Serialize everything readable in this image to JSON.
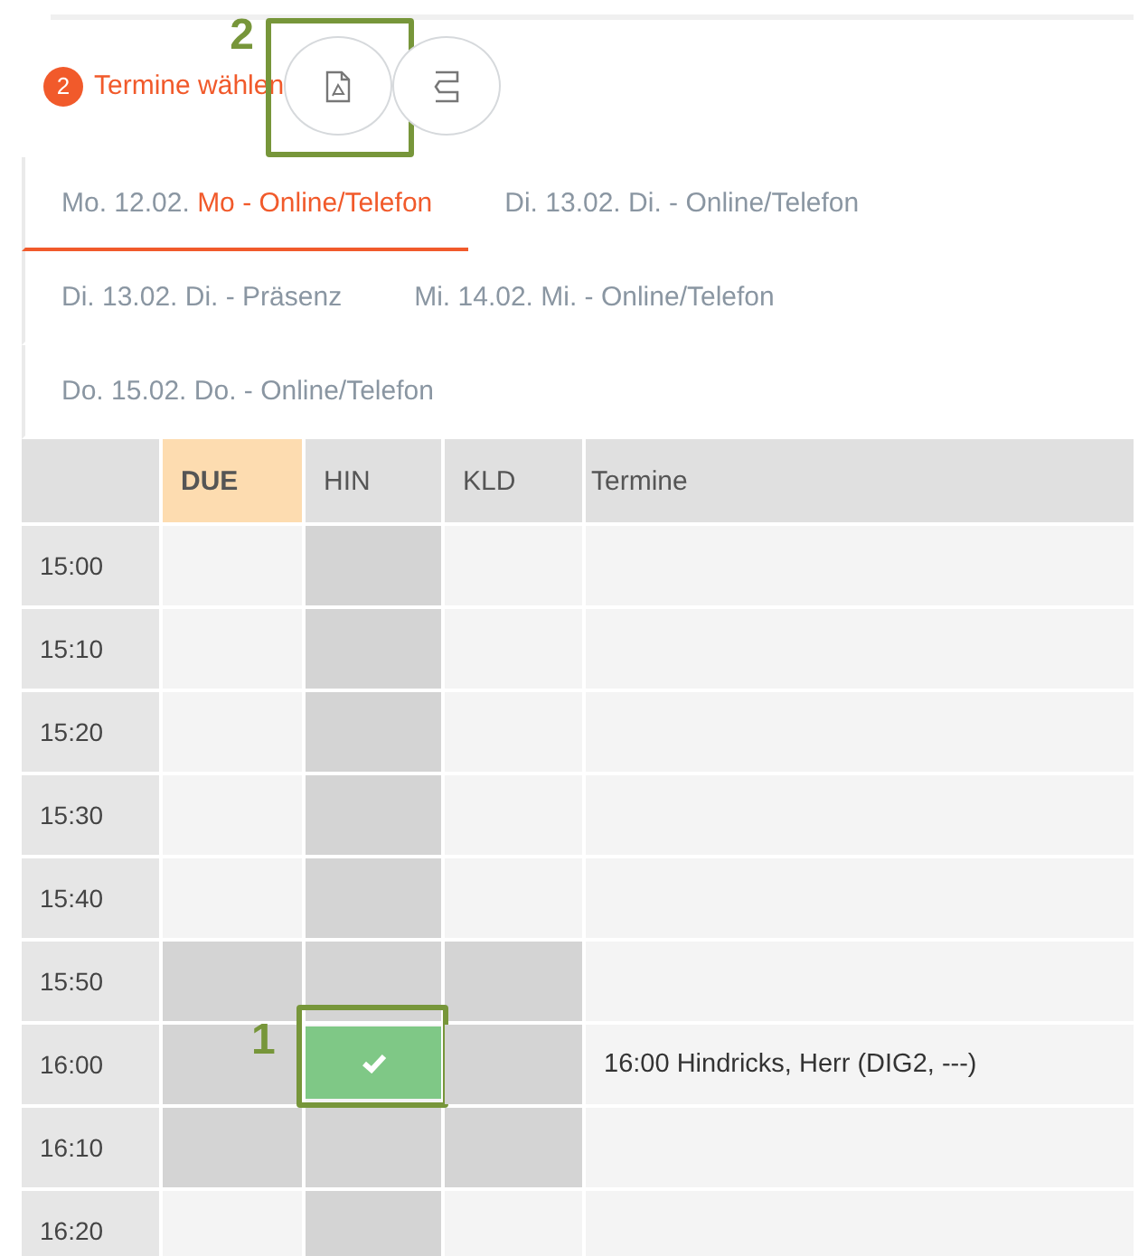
{
  "header": {
    "step": "2",
    "title": "Termine wählen",
    "buttons": [
      {
        "kind": "pdf",
        "callout": "2"
      },
      {
        "kind": "fold"
      }
    ]
  },
  "tabs": [
    {
      "date": "Mo. 12.02.",
      "label": "Mo - Online/Telefon",
      "selected": true
    },
    {
      "date": "Di. 13.02.",
      "label": "Di. - Online/Telefon",
      "selected": false
    },
    {
      "date": "Di. 13.02.",
      "label": "Di. - Präsenz",
      "selected": false
    },
    {
      "date": "Mi. 14.02.",
      "label": "Mi. - Online/Telefon",
      "selected": false
    },
    {
      "date": "Do. 15.02.",
      "label": "Do. - Online/Telefon",
      "selected": false
    }
  ],
  "table": {
    "columns": [
      {
        "label": "DUE",
        "selected": true
      },
      {
        "label": "HIN",
        "selected": false
      },
      {
        "label": "KLD",
        "selected": false
      }
    ],
    "entries_heading": "Termine",
    "rows": [
      {
        "time": "15:00",
        "slots": [
          {
            "kind": "free"
          },
          {
            "kind": "busy"
          },
          {
            "kind": "free"
          }
        ]
      },
      {
        "time": "15:10",
        "slots": [
          {
            "kind": "free"
          },
          {
            "kind": "busy"
          },
          {
            "kind": "free"
          }
        ]
      },
      {
        "time": "15:20",
        "slots": [
          {
            "kind": "free"
          },
          {
            "kind": "busy"
          },
          {
            "kind": "free"
          }
        ]
      },
      {
        "time": "15:30",
        "slots": [
          {
            "kind": "free"
          },
          {
            "kind": "busy"
          },
          {
            "kind": "free"
          }
        ]
      },
      {
        "time": "15:40",
        "slots": [
          {
            "kind": "free"
          },
          {
            "kind": "busy"
          },
          {
            "kind": "free"
          }
        ]
      },
      {
        "time": "15:50",
        "slots": [
          {
            "kind": "busy"
          },
          {
            "kind": "busy"
          },
          {
            "kind": "busy"
          }
        ]
      },
      {
        "time": "16:00",
        "slots": [
          {
            "kind": "busy"
          },
          {
            "kind": "booked",
            "callout": "1"
          },
          {
            "kind": "busy"
          }
        ],
        "entry": "16:00 Hindricks, Herr (DIG2, ---)"
      },
      {
        "time": "16:10",
        "slots": [
          {
            "kind": "busy"
          },
          {
            "kind": "busy"
          },
          {
            "kind": "busy"
          }
        ]
      },
      {
        "time": "16:20",
        "slots": [
          {
            "kind": "free"
          },
          {
            "kind": "busy"
          },
          {
            "kind": "free"
          }
        ]
      }
    ]
  }
}
